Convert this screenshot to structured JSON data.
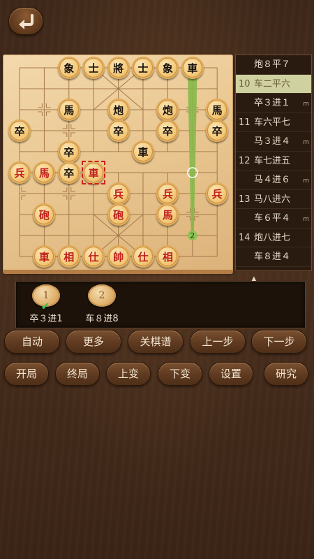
{
  "header": {
    "back_icon": "back-arrow-icon"
  },
  "board": {
    "pieces": [
      {
        "c": "象",
        "side": "black",
        "col": 2,
        "row": 0
      },
      {
        "c": "士",
        "side": "black",
        "col": 3,
        "row": 0
      },
      {
        "c": "將",
        "side": "black",
        "col": 4,
        "row": 0
      },
      {
        "c": "士",
        "side": "black",
        "col": 5,
        "row": 0
      },
      {
        "c": "象",
        "side": "black",
        "col": 6,
        "row": 0
      },
      {
        "c": "車",
        "side": "black",
        "col": 7,
        "row": 0
      },
      {
        "c": "馬",
        "side": "black",
        "col": 2,
        "row": 2
      },
      {
        "c": "炮",
        "side": "black",
        "col": 4,
        "row": 2
      },
      {
        "c": "炮",
        "side": "black",
        "col": 6,
        "row": 2
      },
      {
        "c": "馬",
        "side": "black",
        "col": 8,
        "row": 2
      },
      {
        "c": "卒",
        "side": "black",
        "col": 0,
        "row": 3
      },
      {
        "c": "卒",
        "side": "black",
        "col": 4,
        "row": 3
      },
      {
        "c": "卒",
        "side": "black",
        "col": 6,
        "row": 3
      },
      {
        "c": "卒",
        "side": "black",
        "col": 8,
        "row": 3
      },
      {
        "c": "卒",
        "side": "black",
        "col": 2,
        "row": 4
      },
      {
        "c": "車",
        "side": "black",
        "col": 5,
        "row": 4
      },
      {
        "c": "兵",
        "side": "red",
        "col": 0,
        "row": 5
      },
      {
        "c": "馬",
        "side": "red",
        "col": 1,
        "row": 5
      },
      {
        "c": "卒",
        "side": "black",
        "col": 2,
        "row": 5
      },
      {
        "c": "車",
        "side": "red",
        "col": 3,
        "row": 5
      },
      {
        "c": "兵",
        "side": "red",
        "col": 4,
        "row": 6
      },
      {
        "c": "兵",
        "side": "red",
        "col": 6,
        "row": 6
      },
      {
        "c": "兵",
        "side": "red",
        "col": 8,
        "row": 6
      },
      {
        "c": "砲",
        "side": "red",
        "col": 1,
        "row": 7
      },
      {
        "c": "砲",
        "side": "red",
        "col": 4,
        "row": 7
      },
      {
        "c": "馬",
        "side": "red",
        "col": 6,
        "row": 7
      },
      {
        "c": "車",
        "side": "red",
        "col": 1,
        "row": 9
      },
      {
        "c": "相",
        "side": "red",
        "col": 2,
        "row": 9
      },
      {
        "c": "仕",
        "side": "red",
        "col": 3,
        "row": 9
      },
      {
        "c": "帥",
        "side": "red",
        "col": 4,
        "row": 9
      },
      {
        "c": "仕",
        "side": "red",
        "col": 5,
        "row": 9
      },
      {
        "c": "相",
        "side": "red",
        "col": 6,
        "row": 9
      }
    ],
    "selected": {
      "col": 3,
      "row": 5
    },
    "arrow": {
      "from": {
        "col": 7,
        "row": 0
      },
      "to": {
        "col": 7,
        "row": 8
      }
    },
    "marker_label": "2",
    "hint_circle": {
      "col": 7,
      "row": 5
    }
  },
  "movelist": [
    {
      "num": "",
      "txt": "炮８平７",
      "m": ""
    },
    {
      "num": "10",
      "txt": "车二平六",
      "m": "",
      "active": true
    },
    {
      "num": "",
      "txt": "卒３进１",
      "m": "m"
    },
    {
      "num": "11",
      "txt": "车六平七",
      "m": ""
    },
    {
      "num": "",
      "txt": "马３进４",
      "m": "m"
    },
    {
      "num": "12",
      "txt": "车七进五",
      "m": ""
    },
    {
      "num": "",
      "txt": "马４进６",
      "m": "m"
    },
    {
      "num": "13",
      "txt": "马八进六",
      "m": ""
    },
    {
      "num": "",
      "txt": "车６平４",
      "m": "m"
    },
    {
      "num": "14",
      "txt": "炮八进七",
      "m": ""
    },
    {
      "num": "",
      "txt": "车８进４",
      "m": ""
    }
  ],
  "variations": [
    {
      "n": "1",
      "label": "卒３进1",
      "checked": true
    },
    {
      "n": "2",
      "label": "车８进8",
      "checked": false
    }
  ],
  "buttons_row1": [
    "自动",
    "更多",
    "关棋谱",
    "上一步",
    "下一步"
  ],
  "buttons_row2": [
    "开局",
    "终局",
    "上变",
    "下变",
    "设置",
    "研究"
  ],
  "colors": {
    "red_piece": "#c0201a",
    "black_piece": "#1a120c",
    "active_move": "#cfd2a0",
    "arrow": "#8bc34a"
  }
}
